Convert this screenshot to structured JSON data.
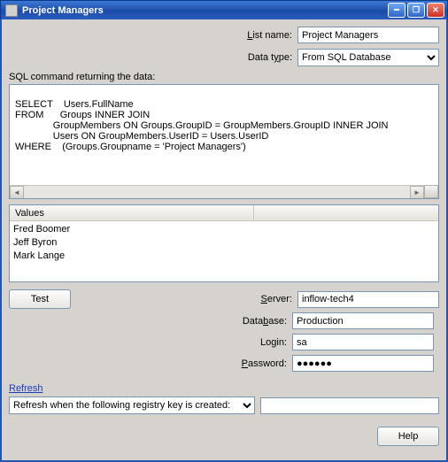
{
  "window": {
    "title": "Project Managers"
  },
  "listName": {
    "label_pre": "",
    "label": "List name:",
    "value": "Project Managers"
  },
  "dataType": {
    "label": "Data type:",
    "value": "From SQL Database"
  },
  "sqlLabel": "SQL command returning the data:",
  "sql": {
    "l1a": "SELECT",
    "l1b": "Users.FullName",
    "l2a": "FROM",
    "l2b": "Groups INNER JOIN",
    "l3": "GroupMembers ON Groups.GroupID = GroupMembers.GroupID INNER JOIN",
    "l4": "Users ON GroupMembers.UserID = Users.UserID",
    "l5a": "WHERE",
    "l5b": "(Groups.Groupname = 'Project Managers')"
  },
  "valuesHeader": "Values",
  "values": [
    "Fred Boomer",
    "Jeff Byron",
    "Mark Lange"
  ],
  "testLabel": "Test",
  "server": {
    "label": "Server:",
    "value": "inflow-tech4"
  },
  "database": {
    "label": "Database:",
    "value": "Production"
  },
  "login": {
    "label": "Login:",
    "value": "sa"
  },
  "password": {
    "label": "Password:",
    "value": "●●●●●●"
  },
  "refreshLink": "Refresh",
  "refreshMode": "Refresh when the following registry key is created:",
  "refreshKey": "",
  "helpLabel": "Help"
}
